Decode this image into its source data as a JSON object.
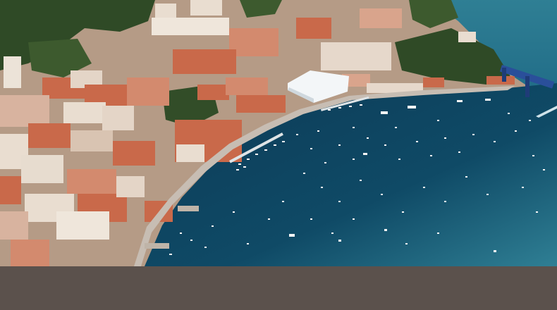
{
  "caption": {
    "text": "",
    "background": "#5b514c",
    "text_color": "#ffffff"
  },
  "photo": {
    "colors": {
      "sea_deep": "#0c3b57",
      "sea_light": "#2f7f94",
      "roof": "#c9694a",
      "wall": "#e9ddd0",
      "vegetation": "#2f4a26",
      "bridge": "#2a4f9a"
    }
  }
}
